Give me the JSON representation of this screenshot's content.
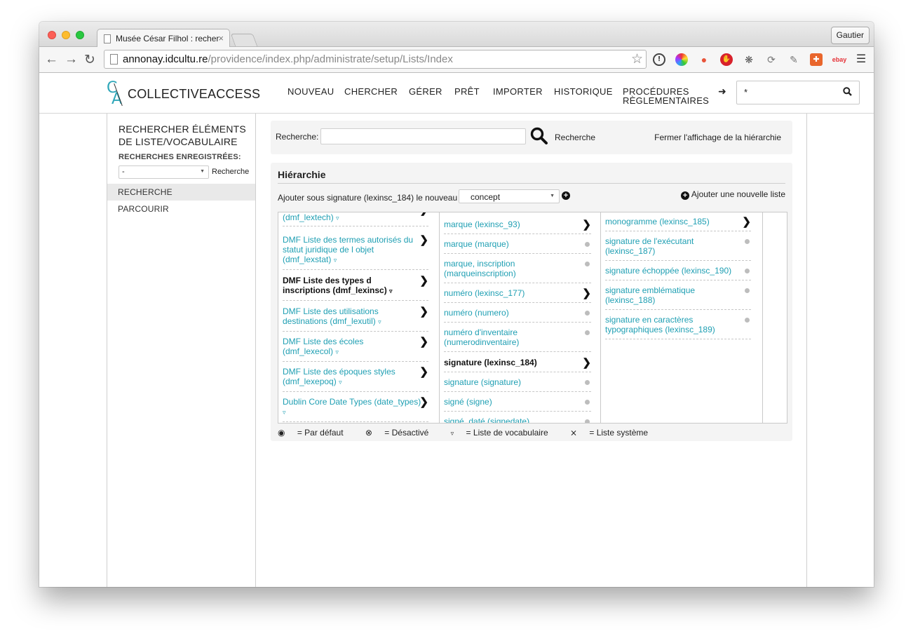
{
  "browser": {
    "tab_title": "Musée César Filhol : recher",
    "tab_close": "×",
    "profile": "Gautier",
    "url_host": "annonay.idcultu.re",
    "url_path": "/providence/index.php/administrate/setup/Lists/Index",
    "extensions": [
      "onepassword-icon",
      "color-wheel-icon",
      "pin-icon",
      "stop-icon",
      "bug-icon",
      "refresh-icon",
      "pen-icon",
      "badge-icon",
      "ebay-icon",
      "menu-icon"
    ]
  },
  "app": {
    "logo_mark": "CA",
    "logo_text": "COLLECTIVEACCESS",
    "nav": [
      "NOUVEAU",
      "CHERCHER",
      "GÉRER",
      "PRÊT",
      "IMPORTER",
      "HISTORIQUE",
      "PROCÉDURES",
      "RÈGLEMENTAIRES"
    ],
    "quick_search_value": "*"
  },
  "sidebar": {
    "title": "RECHERCHER ÉLÉMENTS DE LISTE/VOCABULAIRE",
    "saved_label": "RECHERCHES ENREGISTRÉES:",
    "saved_select": "-",
    "saved_search_link": "Recherche",
    "items": [
      {
        "label": "RECHERCHE",
        "active": true
      },
      {
        "label": "PARCOURIR",
        "active": false
      }
    ]
  },
  "search": {
    "label": "Recherche:",
    "value": "",
    "button": "Recherche",
    "close_hierarchy": "Fermer l'affichage de la hiérarchie"
  },
  "hierarchy": {
    "title": "Hiérarchie",
    "add_under_label": "Ajouter sous signature (lexinsc_184) le nouveau",
    "type_select": "concept",
    "add_list": "Ajouter une nouvelle liste",
    "col1": [
      "(dmf_lextech)",
      "DMF Liste des termes autorisés du statut juridique de l objet (dmf_lexstat)",
      "DMF Liste des types d inscriptions (dmf_lexinsc)",
      "DMF Liste des utilisations destinations (dmf_lexutil)",
      "DMF Liste des écoles (dmf_lexecol)",
      "DMF Liste des époques styles (dmf_lexepoq)",
      "Dublin Core Date Types (date_types)"
    ],
    "col2": [
      "marque (lexinsc_93)",
      "marque (marque)",
      "marque, inscription (marqueinscription)",
      "numéro (lexinsc_177)",
      "numéro (numero)",
      "numéro d'inventaire (numerodinventaire)",
      "signature (lexinsc_184)",
      "signature (signature)",
      "signé (signe)",
      "signé, daté (signedate)"
    ],
    "col3": [
      "monogramme (lexinsc_185)",
      "signature de l'exécutant (lexinsc_187)",
      "signature échoppée (lexinsc_190)",
      "signature emblématique (lexinsc_188)",
      "signature en caractères typographiques (lexinsc_189)"
    ],
    "legend": {
      "default": "= Par défaut",
      "disabled": "= Désactivé",
      "vocab": "= Liste de vocabulaire",
      "system": "= Liste système"
    }
  },
  "colors": {
    "accent": "#1f9fb3",
    "logo": "#2fa7b9",
    "panel": "#f4f4f4"
  }
}
